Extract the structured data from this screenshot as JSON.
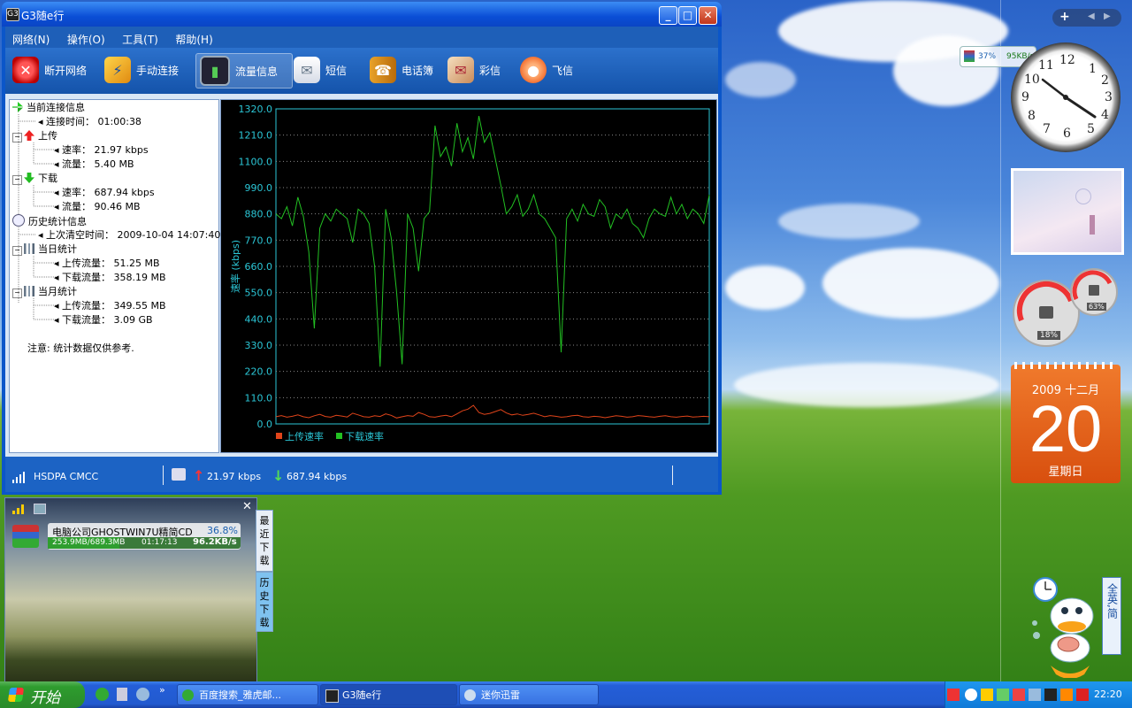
{
  "window": {
    "title": "G3随e行",
    "app_icon_text": "G3"
  },
  "menu": [
    "网络(N)",
    "操作(O)",
    "工具(T)",
    "帮助(H)"
  ],
  "toolbar": [
    {
      "label": "断开网络",
      "icon": "disconnect-icon"
    },
    {
      "label": "手动连接",
      "icon": "connect-icon"
    },
    {
      "label": "流量信息",
      "icon": "traffic-icon",
      "active": true
    },
    {
      "label": "短信",
      "icon": "sms-icon"
    },
    {
      "label": "电话簿",
      "icon": "phonebook-icon"
    },
    {
      "label": "彩信",
      "icon": "mms-icon"
    },
    {
      "label": "飞信",
      "icon": "fetion-icon"
    }
  ],
  "tree": {
    "current": "当前连接信息",
    "conn_time_label": "连接时间：",
    "conn_time": "01:00:38",
    "upload": "上传",
    "up_rate_label": "速率：",
    "up_rate": "21.97 kbps",
    "up_flow_label": "流量：",
    "up_flow": "5.40 MB",
    "download": "下载",
    "down_rate_label": "速率：",
    "down_rate": "687.94 kbps",
    "down_flow_label": "流量：",
    "down_flow": "90.46 MB",
    "history": "历史统计信息",
    "last_clear_label": "上次清空时间：",
    "last_clear": "2009-10-04 14:07:40",
    "day": "当日统计",
    "day_up_label": "上传流量：",
    "day_up": "51.25 MB",
    "day_down_label": "下载流量：",
    "day_down": "358.19 MB",
    "month": "当月统计",
    "month_up_label": "上传流量：",
    "month_up": "349.55 MB",
    "month_down_label": "下载流量：",
    "month_down": "3.09 GB",
    "note": "注意: 统计数据仅供参考."
  },
  "chart_data": {
    "type": "line",
    "ylabel": "速率 (kbps)",
    "ylim": [
      0,
      1320
    ],
    "yticks": [
      "1320.0",
      "1210.0",
      "1100.0",
      "990.0",
      "880.0",
      "770.0",
      "660.0",
      "550.0",
      "440.0",
      "330.0",
      "220.0",
      "110.0",
      "0.0"
    ],
    "grid": true,
    "legend": [
      "上传速率",
      "下载速率"
    ],
    "colors": {
      "upload": "#e0441a",
      "download": "#22c022",
      "axis": "#2bc6d6",
      "background": "#000000"
    },
    "series": [
      {
        "name": "上传速率",
        "values": [
          30,
          35,
          28,
          32,
          38,
          30,
          26,
          34,
          40,
          31,
          28,
          36,
          33,
          29,
          45,
          38,
          30,
          28,
          34,
          31,
          42,
          36,
          25,
          30,
          35,
          32,
          48,
          40,
          30,
          28,
          33,
          36,
          30,
          42,
          55,
          62,
          78,
          48,
          40,
          44,
          52,
          60,
          46,
          38,
          42,
          36,
          40,
          45,
          38,
          30,
          35,
          32,
          28,
          30,
          34,
          36,
          30,
          28,
          32,
          30,
          26,
          30,
          34,
          32,
          28,
          30,
          35,
          33,
          30,
          28,
          32,
          34,
          30,
          28,
          31,
          33,
          29,
          30,
          32,
          30
        ]
      },
      {
        "name": "下载速率",
        "values": [
          880,
          860,
          910,
          830,
          950,
          870,
          720,
          400,
          820,
          880,
          850,
          900,
          880,
          860,
          760,
          900,
          880,
          840,
          660,
          240,
          900,
          780,
          550,
          250,
          880,
          820,
          640,
          860,
          890,
          1250,
          1120,
          1160,
          1080,
          1260,
          1140,
          1200,
          1110,
          1290,
          1180,
          1220,
          1110,
          1000,
          880,
          910,
          960,
          870,
          900,
          960,
          880,
          860,
          820,
          780,
          300,
          860,
          900,
          850,
          920,
          880,
          870,
          940,
          910,
          820,
          880,
          860,
          900,
          840,
          820,
          780,
          860,
          900,
          880,
          870,
          950,
          880,
          920,
          860,
          900,
          880,
          840,
          960
        ]
      }
    ]
  },
  "status": {
    "network": "HSDPA CMCC",
    "up": "21.97 kbps",
    "down": "687.94 kbps"
  },
  "gadgets": {
    "net_cpu": "37%",
    "net_speed": "95KB/s",
    "meter_cpu": "18%",
    "meter_mem": "63%",
    "calendar_month": "2009 十二月",
    "calendar_day": "20",
    "calendar_weekday": "星期日"
  },
  "download_panel": {
    "item_name": "电脑公司GHOSTWIN7U精简CD",
    "item_percent": "36.8%",
    "item_size": "253.9MB/689.3MB",
    "item_time": "01:17:13",
    "item_speed": "96.2KB/s",
    "tab_recent": "最近下载",
    "tab_history": "历史下载"
  },
  "ime": "全英,简",
  "taskbar": {
    "start": "开始",
    "tasks": [
      "百度搜索_雅虎邮...",
      "G3随e行",
      "迷你迅雷"
    ],
    "clock": "22:20"
  }
}
